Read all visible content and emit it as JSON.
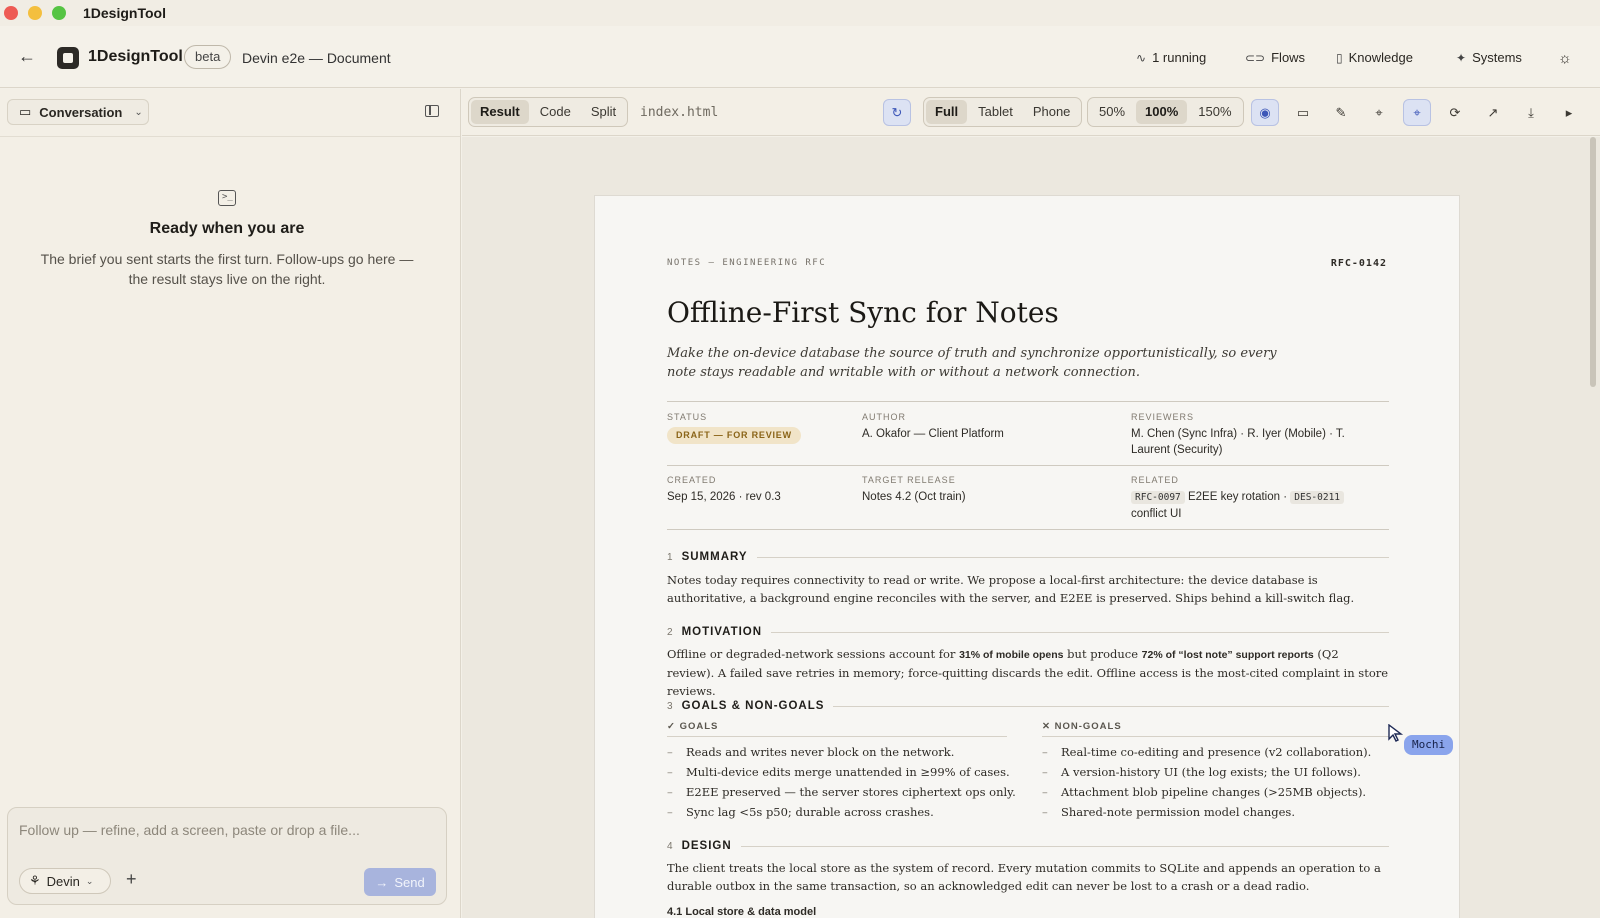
{
  "window": {
    "title": "1DesignTool"
  },
  "header": {
    "brand": "1DesignTool",
    "badge": "beta",
    "doc_title": "Devin e2e — Document",
    "nav": {
      "running": "1 running",
      "flows": "Flows",
      "knowledge": "Knowledge",
      "systems": "Systems"
    }
  },
  "sidebar": {
    "selector_label": "Conversation",
    "empty_title": "Ready when you are",
    "empty_text": "The brief you sent starts the first turn. Follow-ups go here — the result stays live on the right.",
    "composer": {
      "placeholder": "Follow up — refine, add a screen, paste or drop a file...",
      "agent": "Devin",
      "send": "Send"
    }
  },
  "toolbar": {
    "view_modes": [
      "Result",
      "Code",
      "Split"
    ],
    "active_view": "Result",
    "filename": "index.html",
    "devices": [
      "Full",
      "Tablet",
      "Phone"
    ],
    "active_device": "Full",
    "zoom": [
      "50%",
      "100%",
      "150%"
    ],
    "active_zoom": "100%"
  },
  "document": {
    "eyebrow": "NOTES — ENGINEERING RFC",
    "id": "RFC-0142",
    "title": "Offline-First Sync for Notes",
    "lede": "Make the on-device database the source of truth and synchronize opportunistically, so every note stays readable and writable with or without a network connection.",
    "meta": {
      "status_label": "STATUS",
      "status": "DRAFT — FOR REVIEW",
      "author_label": "AUTHOR",
      "author": "A. Okafor — Client Platform",
      "reviewers_label": "REVIEWERS",
      "reviewers": "M. Chen (Sync Infra) · R. Iyer (Mobile) · T. Laurent (Security)",
      "created_label": "CREATED",
      "created": "Sep 15, 2026 · rev 0.3",
      "target_label": "TARGET RELEASE",
      "target": "Notes 4.2 (Oct train)",
      "related_label": "RELATED",
      "related_code_1": "RFC-0097",
      "related_text_1": "E2EE key rotation ·",
      "related_code_2": "DES-0211",
      "related_text_2": "conflict UI"
    },
    "sections": {
      "s1_num": "1",
      "s1_title": "SUMMARY",
      "s1_text": "Notes today requires connectivity to read or write. We propose a local-first architecture: the device database is authoritative, a background engine reconciles with the server, and E2EE is preserved. Ships behind a kill-switch flag.",
      "s2_num": "2",
      "s2_title": "MOTIVATION",
      "s2_pre": "Offline or degraded-network sessions account for ",
      "s2_b1": "31% of mobile opens",
      "s2_mid": " but produce ",
      "s2_b2": "72% of “lost note” support reports",
      "s2_post": " (Q2 review). A failed save retries in memory; force-quitting discards the edit. Offline access is the most-cited complaint in store reviews.",
      "s3_num": "3",
      "s3_title": "GOALS & NON-GOALS",
      "goals_label": "✓ GOALS",
      "goals": [
        "Reads and writes never block on the network.",
        "Multi-device edits merge unattended in ≥99% of cases.",
        "E2EE preserved — the server stores ciphertext ops only.",
        "Sync lag <5s p50; durable across crashes."
      ],
      "nongoals_label": "✕ NON-GOALS",
      "nongoals": [
        "Real-time co-editing and presence (v2 collaboration).",
        "A version-history UI (the log exists; the UI follows).",
        "Attachment blob pipeline changes (>25MB objects).",
        "Shared-note permission model changes."
      ],
      "s4_num": "4",
      "s4_title": "DESIGN",
      "s4_text": "The client treats the local store as the system of record. Every mutation commits to SQLite and appends an operation to a durable outbox in the same transaction, so an acknowledged edit can never be lost to a crash or a dead radio.",
      "s41_text": "4.1   Local store & data model"
    }
  },
  "cursor_label": "Mochi",
  "colors": {
    "accent": "#3d57b8",
    "badge_bg": "#f1e4c8",
    "badge_fg": "#8a6418",
    "send_bg": "#a8b4dd"
  }
}
